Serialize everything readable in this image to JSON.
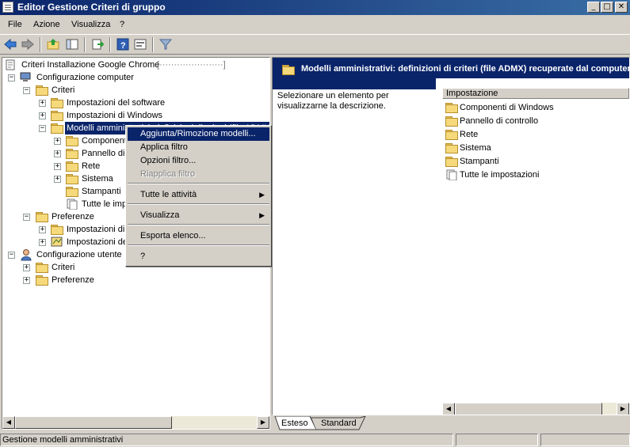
{
  "window": {
    "title": "Editor Gestione Criteri di gruppo"
  },
  "menubar": {
    "items": [
      "File",
      "Azione",
      "Visualizza",
      "?"
    ]
  },
  "tree": {
    "root": "Criteri Installazione Google Chrome",
    "computer_config": "Configurazione computer",
    "criteri": "Criteri",
    "software": "Impostazioni del software",
    "windows": "Impostazioni di Windows",
    "admin_templates": "Modelli amministrativi: definizioni di criteri (file ADMX)",
    "componenti": "Componenti di Windows",
    "pannello": "Pannello di controllo",
    "rete": "Rete",
    "sistema": "Sistema",
    "stampanti": "Stampanti",
    "tutte": "Tutte le impostazioni",
    "preferenze": "Preferenze",
    "impostazioni_di_win": "Impostazioni di Windows",
    "impostazioni_del_pannello": "Impostazioni del Pannello di controllo",
    "user_config": "Configurazione utente",
    "user_criteri": "Criteri",
    "user_preferenze": "Preferenze"
  },
  "context_menu": {
    "add_remove": "Aggiunta/Rimozione modelli...",
    "apply_filter": "Applica filtro",
    "filter_options": "Opzioni filtro...",
    "reapply_filter": "Riapplica filtro",
    "all_tasks": "Tutte le attività",
    "view": "Visualizza",
    "export": "Esporta elenco...",
    "help": "?"
  },
  "right": {
    "header": "Modelli amministrativi: definizioni di criteri (file ADMX) recuperate dal computer locale.",
    "description": "Selezionare un elemento per visualizzarne la descrizione.",
    "column": "Impostazione",
    "items": [
      "Componenti di Windows",
      "Pannello di controllo",
      "Rete",
      "Sistema",
      "Stampanti",
      "Tutte le impostazioni"
    ]
  },
  "tabs": {
    "extended": "Esteso",
    "standard": "Standard"
  },
  "status": {
    "text": "Gestione modelli amministrativi"
  },
  "colors": {
    "selection": "#0a246a",
    "folder": "#f6d97a",
    "window_bg": "#d4d0c8"
  }
}
